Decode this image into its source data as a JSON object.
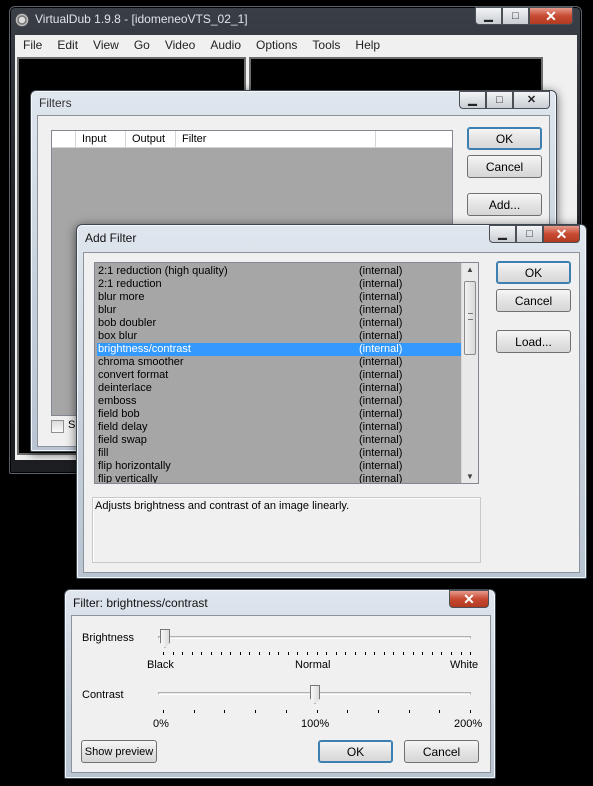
{
  "main_window": {
    "title": "VirtualDub 1.9.8 - [idomeneoVTS_02_1]",
    "menu": [
      "File",
      "Edit",
      "View",
      "Go",
      "Video",
      "Audio",
      "Options",
      "Tools",
      "Help"
    ],
    "caption_buttons": {
      "minimize": "▁",
      "maximize": "□",
      "close": "✕"
    }
  },
  "filters_dialog": {
    "title": "Filters",
    "columns": [
      "Input",
      "Output",
      "Filter"
    ],
    "ok": "OK",
    "cancel": "Cancel",
    "add": "Add...",
    "bottom_checkbox_label": "Sh"
  },
  "add_filter_dialog": {
    "title": "Add Filter",
    "selected_index": 6,
    "filters": [
      {
        "name": "2:1 reduction (high quality)",
        "type": "(internal)"
      },
      {
        "name": "2:1 reduction",
        "type": "(internal)"
      },
      {
        "name": "blur more",
        "type": "(internal)"
      },
      {
        "name": "blur",
        "type": "(internal)"
      },
      {
        "name": "bob doubler",
        "type": "(internal)"
      },
      {
        "name": "box blur",
        "type": "(internal)"
      },
      {
        "name": "brightness/contrast",
        "type": "(internal)"
      },
      {
        "name": "chroma smoother",
        "type": "(internal)"
      },
      {
        "name": "convert format",
        "type": "(internal)"
      },
      {
        "name": "deinterlace",
        "type": "(internal)"
      },
      {
        "name": "emboss",
        "type": "(internal)"
      },
      {
        "name": "field bob",
        "type": "(internal)"
      },
      {
        "name": "field delay",
        "type": "(internal)"
      },
      {
        "name": "field swap",
        "type": "(internal)"
      },
      {
        "name": "fill",
        "type": "(internal)"
      },
      {
        "name": "flip horizontally",
        "type": "(internal)"
      },
      {
        "name": "flip vertically",
        "type": "(internal)"
      }
    ],
    "description": "Adjusts brightness and contrast of an image linearly.",
    "ok": "OK",
    "cancel": "Cancel",
    "load": "Load..."
  },
  "bc_dialog": {
    "title": "Filter: brightness/contrast",
    "brightness_label": "Brightness",
    "brightness_value": 0.0,
    "brightness_ticks": [
      "Black",
      "Normal",
      "White"
    ],
    "contrast_label": "Contrast",
    "contrast_value": 0.5,
    "contrast_ticks": [
      "0%",
      "100%",
      "200%"
    ],
    "show_preview": "Show preview",
    "ok": "OK",
    "cancel": "Cancel"
  },
  "colors": {
    "selection": "#3399ff",
    "list_bg": "#a6a6a6"
  }
}
